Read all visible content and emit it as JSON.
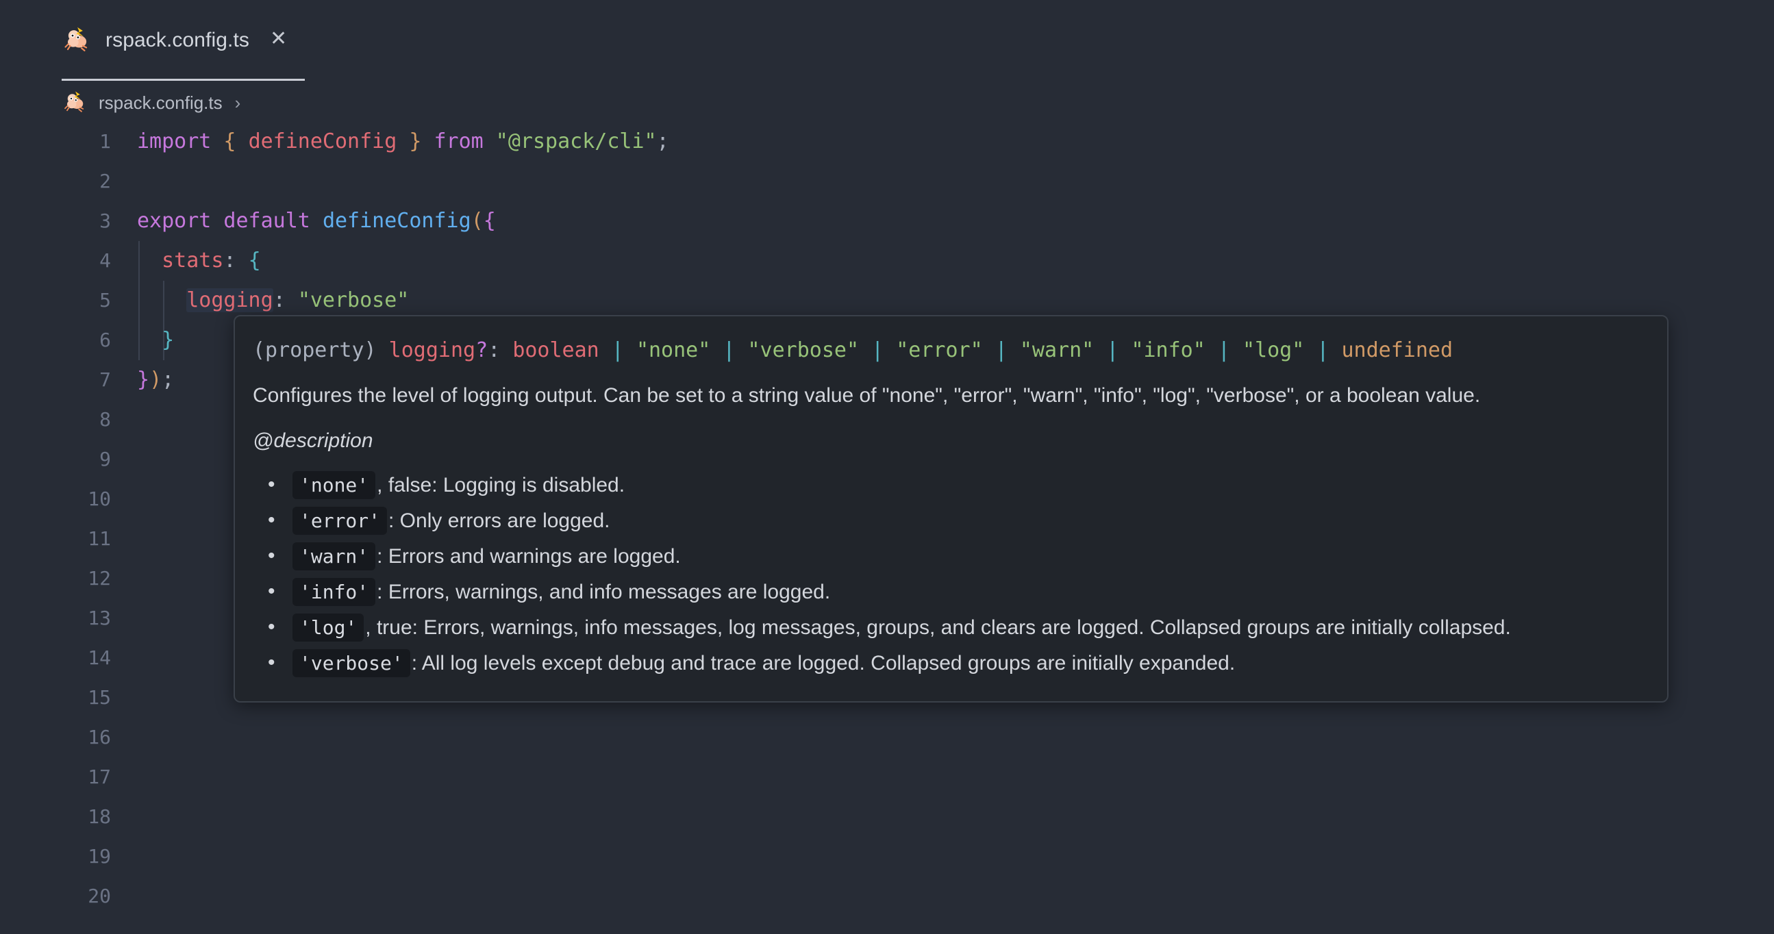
{
  "window": {
    "background": "#272c36",
    "theme_name": "dark"
  },
  "tabbar": {
    "tabs": [
      {
        "label": "rspack.config.ts",
        "icon": "rspack-logo-icon",
        "close_label": "✕",
        "active": true
      }
    ]
  },
  "breadcrumb": {
    "icon": "rspack-logo-icon",
    "label": "rspack.config.ts",
    "separator": "›"
  },
  "editor": {
    "language": "typescript",
    "line_numbers": [
      "1",
      "2",
      "3",
      "4",
      "5",
      "6",
      "7",
      "8",
      "9",
      "10",
      "11",
      "12",
      "13",
      "14",
      "15",
      "16",
      "17",
      "18",
      "19",
      "20"
    ],
    "lines": [
      {
        "n": "1",
        "text": "import { defineConfig } from \"@rspack/cli\";"
      },
      {
        "n": "2",
        "text": ""
      },
      {
        "n": "3",
        "text": "export default defineConfig({"
      },
      {
        "n": "4",
        "text": "  stats: {"
      },
      {
        "n": "5",
        "text": "    logging: \"verbose\""
      },
      {
        "n": "6",
        "text": "  }"
      },
      {
        "n": "7",
        "text": "});"
      },
      {
        "n": "8",
        "text": ""
      },
      {
        "n": "9",
        "text": ""
      },
      {
        "n": "10",
        "text": ""
      },
      {
        "n": "11",
        "text": ""
      },
      {
        "n": "12",
        "text": ""
      },
      {
        "n": "13",
        "text": ""
      },
      {
        "n": "14",
        "text": ""
      },
      {
        "n": "15",
        "text": ""
      },
      {
        "n": "16",
        "text": ""
      },
      {
        "n": "17",
        "text": ""
      },
      {
        "n": "18",
        "text": ""
      },
      {
        "n": "19",
        "text": ""
      },
      {
        "n": "20",
        "text": ""
      }
    ],
    "tokens": {
      "l1": {
        "import": "import",
        "brace_open": " { ",
        "defineConfig": "defineConfig",
        "brace_close": " } ",
        "from": "from",
        "module": " \"@rspack/cli\"",
        "semi": ";"
      },
      "l3": {
        "export": "export",
        "default": " default ",
        "defineConfig": "defineConfig",
        "paren": "(",
        "brace": "{"
      },
      "l4": {
        "indent": "  ",
        "key": "stats",
        "colon": ": ",
        "brace": "{"
      },
      "l5": {
        "indent": "    ",
        "key": "logging",
        "colon": ": ",
        "value": "\"verbose\""
      },
      "l6": {
        "indent": "  ",
        "brace": "}"
      },
      "l7": {
        "brace": "}",
        "paren": ")",
        "semi": ";"
      }
    },
    "colors": {
      "keyword": "#c678dd",
      "property": "#e06c75",
      "function": "#61afef",
      "string": "#98c379",
      "punctuation": "#abb2bf",
      "brace_orange": "#d19a66",
      "brace_cyan": "#56b6c2",
      "line_number": "#6b7385"
    }
  },
  "tooltip": {
    "signature": {
      "prefix": "(property)",
      "name": " logging",
      "optional": "?",
      "colon": ": ",
      "base_type": "boolean",
      "separator": " | ",
      "union": [
        "\"none\"",
        "\"verbose\"",
        "\"error\"",
        "\"warn\"",
        "\"info\"",
        "\"log\""
      ],
      "undefined": "undefined"
    },
    "description": "Configures the level of logging output. Can be set to a string value of \"none\", \"error\", \"warn\", \"info\", \"log\", \"verbose\", or a boolean value.",
    "tag": "@description",
    "items": [
      {
        "code": "'none'",
        "text": ", false: Logging is disabled."
      },
      {
        "code": "'error'",
        "text": ": Only errors are logged."
      },
      {
        "code": "'warn'",
        "text": ": Errors and warnings are logged."
      },
      {
        "code": "'info'",
        "text": ": Errors, warnings, and info messages are logged."
      },
      {
        "code": "'log'",
        "text": ", true: Errors, warnings, info messages, log messages, groups, and clears are logged. Collapsed groups are initially collapsed."
      },
      {
        "code": "'verbose'",
        "text": ": All log levels except debug and trace are logged. Collapsed groups are initially expanded."
      }
    ],
    "colors": {
      "background": "#21252b",
      "border": "#3a4049",
      "text": "#d4d7dd",
      "code_background": "#16191e"
    }
  }
}
